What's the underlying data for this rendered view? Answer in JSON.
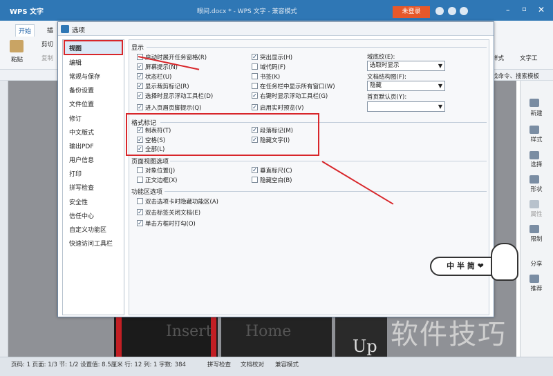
{
  "app": {
    "name": "WPS 文字",
    "doc_title": "眼间.docx * - WPS 文字 - 兼容模式",
    "login_label": "未登录"
  },
  "ribbon": {
    "tab_start": "开始",
    "tab_insert": "插",
    "paste": "粘贴",
    "cut": "剪切",
    "copy": "复制",
    "style": "样式",
    "text_tool": "文字工",
    "search_hint": "找命令、搜索模板"
  },
  "dialog": {
    "title": "选项"
  },
  "nav": {
    "items": [
      "视图",
      "编辑",
      "常规与保存",
      "备份设置",
      "文件位置",
      "修订",
      "中文版式",
      "输出PDF",
      "用户信息",
      "打印",
      "拼写检查",
      "安全性",
      "信任中心",
      "自定义功能区",
      "快速访问工具栏"
    ]
  },
  "display": {
    "section": "显示",
    "left": [
      {
        "label": "启动时展开任务窗格(R)",
        "checked": false
      },
      {
        "label": "屏幕提示(N)",
        "checked": true
      },
      {
        "label": "状态栏(U)",
        "checked": true
      },
      {
        "label": "显示裁剪标记(R)",
        "checked": true
      },
      {
        "label": "选择时显示浮动工具栏(D)",
        "checked": true
      },
      {
        "label": "进入页眉页脚提示(Q)",
        "checked": true
      }
    ],
    "mid": [
      {
        "label": "突出显示(H)",
        "checked": true
      },
      {
        "label": "域代码(F)",
        "checked": false
      },
      {
        "label": "书签(K)",
        "checked": false
      },
      {
        "label": "在任务栏中显示所有窗口(W)",
        "checked": false
      },
      {
        "label": "右键时显示浮动工具栏(G)",
        "checked": true
      },
      {
        "label": "启用实时预览(V)",
        "checked": true
      }
    ],
    "underline_label": "域底纹(E):",
    "underline_value": "选取时显示",
    "docmap_label": "文档结构图(F):",
    "docmap_value": "隐藏",
    "firstpage_label": "首页默认页(Y):",
    "firstpage_value": ""
  },
  "format": {
    "section": "格式标记",
    "items": [
      {
        "label": "制表符(T)",
        "checked": true
      },
      {
        "label": "段落标记(M)",
        "checked": true
      },
      {
        "label": "空格(S)",
        "checked": true
      },
      {
        "label": "隐藏文字(I)",
        "checked": true
      },
      {
        "label": "全部(L)",
        "checked": true
      }
    ]
  },
  "pageview": {
    "section": "页面视图选项",
    "items": [
      {
        "label": "对象位置(J)",
        "checked": false
      },
      {
        "label": "垂直标尺(C)",
        "checked": true
      },
      {
        "label": "正文边框(X)",
        "checked": false
      },
      {
        "label": "隐藏空白(B)",
        "checked": false
      }
    ]
  },
  "ribbonopts": {
    "section": "功能区选项",
    "items": [
      {
        "label": "双击选项卡时隐藏功能区(A)",
        "checked": false
      },
      {
        "label": "双击标签关闭文档(E)",
        "checked": true
      },
      {
        "label": "单击方框时打勾(O)",
        "checked": true
      }
    ]
  },
  "right_panel": {
    "items": [
      "新建",
      "样式",
      "选择",
      "形状",
      "属性",
      "限制",
      "分享",
      "推荐"
    ]
  },
  "doc_bg_text": {
    "insert": "Insert",
    "home": "Home",
    "up": "Up"
  },
  "sticker": {
    "text": "中 半 简 ❤"
  },
  "watermark": {
    "text": "软件技巧"
  },
  "status": {
    "text": "页码: 1  页面: 1/3  节: 1/2  设置值: 8.5厘米  行: 12  列: 1  字数: 384",
    "spell": "拼写检查",
    "proof": "文档校对",
    "mode": "兼容模式"
  },
  "colors": {
    "title_blue": "#2f77b5",
    "login_orange": "#e7582a",
    "annotation_red": "#d8262a"
  }
}
